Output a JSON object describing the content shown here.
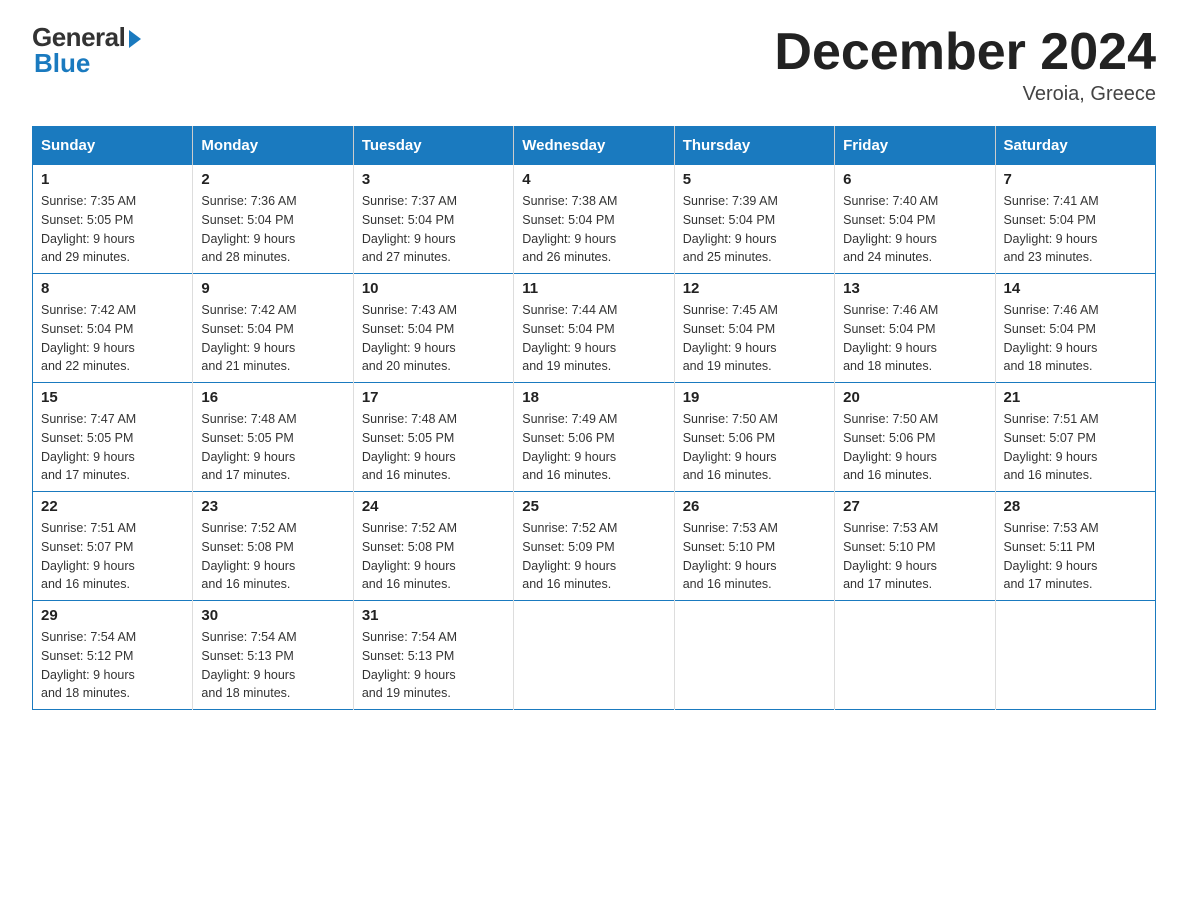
{
  "header": {
    "logo_general": "General",
    "logo_blue": "Blue",
    "month_title": "December 2024",
    "location": "Veroia, Greece"
  },
  "days_of_week": [
    "Sunday",
    "Monday",
    "Tuesday",
    "Wednesday",
    "Thursday",
    "Friday",
    "Saturday"
  ],
  "weeks": [
    [
      {
        "day": 1,
        "sunrise": "7:35 AM",
        "sunset": "5:05 PM",
        "daylight": "9 hours and 29 minutes."
      },
      {
        "day": 2,
        "sunrise": "7:36 AM",
        "sunset": "5:04 PM",
        "daylight": "9 hours and 28 minutes."
      },
      {
        "day": 3,
        "sunrise": "7:37 AM",
        "sunset": "5:04 PM",
        "daylight": "9 hours and 27 minutes."
      },
      {
        "day": 4,
        "sunrise": "7:38 AM",
        "sunset": "5:04 PM",
        "daylight": "9 hours and 26 minutes."
      },
      {
        "day": 5,
        "sunrise": "7:39 AM",
        "sunset": "5:04 PM",
        "daylight": "9 hours and 25 minutes."
      },
      {
        "day": 6,
        "sunrise": "7:40 AM",
        "sunset": "5:04 PM",
        "daylight": "9 hours and 24 minutes."
      },
      {
        "day": 7,
        "sunrise": "7:41 AM",
        "sunset": "5:04 PM",
        "daylight": "9 hours and 23 minutes."
      }
    ],
    [
      {
        "day": 8,
        "sunrise": "7:42 AM",
        "sunset": "5:04 PM",
        "daylight": "9 hours and 22 minutes."
      },
      {
        "day": 9,
        "sunrise": "7:42 AM",
        "sunset": "5:04 PM",
        "daylight": "9 hours and 21 minutes."
      },
      {
        "day": 10,
        "sunrise": "7:43 AM",
        "sunset": "5:04 PM",
        "daylight": "9 hours and 20 minutes."
      },
      {
        "day": 11,
        "sunrise": "7:44 AM",
        "sunset": "5:04 PM",
        "daylight": "9 hours and 19 minutes."
      },
      {
        "day": 12,
        "sunrise": "7:45 AM",
        "sunset": "5:04 PM",
        "daylight": "9 hours and 19 minutes."
      },
      {
        "day": 13,
        "sunrise": "7:46 AM",
        "sunset": "5:04 PM",
        "daylight": "9 hours and 18 minutes."
      },
      {
        "day": 14,
        "sunrise": "7:46 AM",
        "sunset": "5:04 PM",
        "daylight": "9 hours and 18 minutes."
      }
    ],
    [
      {
        "day": 15,
        "sunrise": "7:47 AM",
        "sunset": "5:05 PM",
        "daylight": "9 hours and 17 minutes."
      },
      {
        "day": 16,
        "sunrise": "7:48 AM",
        "sunset": "5:05 PM",
        "daylight": "9 hours and 17 minutes."
      },
      {
        "day": 17,
        "sunrise": "7:48 AM",
        "sunset": "5:05 PM",
        "daylight": "9 hours and 16 minutes."
      },
      {
        "day": 18,
        "sunrise": "7:49 AM",
        "sunset": "5:06 PM",
        "daylight": "9 hours and 16 minutes."
      },
      {
        "day": 19,
        "sunrise": "7:50 AM",
        "sunset": "5:06 PM",
        "daylight": "9 hours and 16 minutes."
      },
      {
        "day": 20,
        "sunrise": "7:50 AM",
        "sunset": "5:06 PM",
        "daylight": "9 hours and 16 minutes."
      },
      {
        "day": 21,
        "sunrise": "7:51 AM",
        "sunset": "5:07 PM",
        "daylight": "9 hours and 16 minutes."
      }
    ],
    [
      {
        "day": 22,
        "sunrise": "7:51 AM",
        "sunset": "5:07 PM",
        "daylight": "9 hours and 16 minutes."
      },
      {
        "day": 23,
        "sunrise": "7:52 AM",
        "sunset": "5:08 PM",
        "daylight": "9 hours and 16 minutes."
      },
      {
        "day": 24,
        "sunrise": "7:52 AM",
        "sunset": "5:08 PM",
        "daylight": "9 hours and 16 minutes."
      },
      {
        "day": 25,
        "sunrise": "7:52 AM",
        "sunset": "5:09 PM",
        "daylight": "9 hours and 16 minutes."
      },
      {
        "day": 26,
        "sunrise": "7:53 AM",
        "sunset": "5:10 PM",
        "daylight": "9 hours and 16 minutes."
      },
      {
        "day": 27,
        "sunrise": "7:53 AM",
        "sunset": "5:10 PM",
        "daylight": "9 hours and 17 minutes."
      },
      {
        "day": 28,
        "sunrise": "7:53 AM",
        "sunset": "5:11 PM",
        "daylight": "9 hours and 17 minutes."
      }
    ],
    [
      {
        "day": 29,
        "sunrise": "7:54 AM",
        "sunset": "5:12 PM",
        "daylight": "9 hours and 18 minutes."
      },
      {
        "day": 30,
        "sunrise": "7:54 AM",
        "sunset": "5:13 PM",
        "daylight": "9 hours and 18 minutes."
      },
      {
        "day": 31,
        "sunrise": "7:54 AM",
        "sunset": "5:13 PM",
        "daylight": "9 hours and 19 minutes."
      },
      null,
      null,
      null,
      null
    ]
  ],
  "labels": {
    "sunrise_prefix": "Sunrise: ",
    "sunset_prefix": "Sunset: ",
    "daylight_prefix": "Daylight: "
  }
}
